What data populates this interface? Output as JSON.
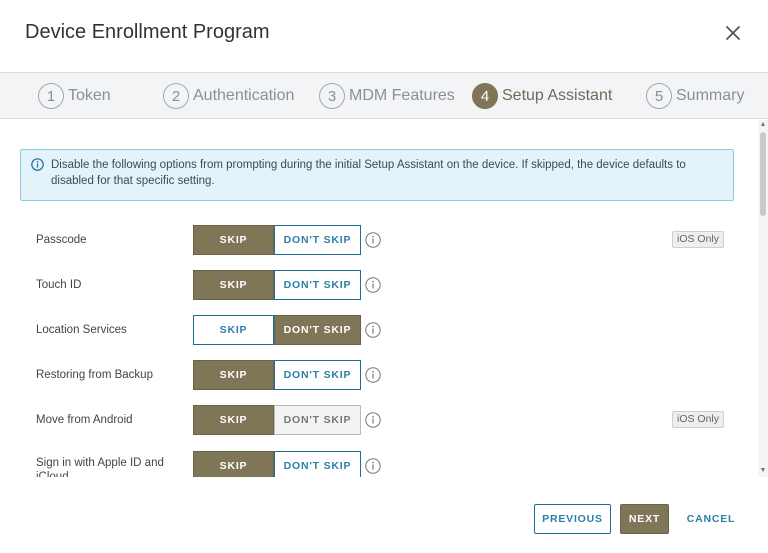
{
  "dialog": {
    "title": "Device Enrollment Program"
  },
  "steps": [
    {
      "num": "1",
      "label": "Token"
    },
    {
      "num": "2",
      "label": "Authentication"
    },
    {
      "num": "3",
      "label": "MDM Features"
    },
    {
      "num": "4",
      "label": "Setup Assistant",
      "active": true
    },
    {
      "num": "5",
      "label": "Summary"
    }
  ],
  "info": {
    "text": "Disable the following options from prompting during the initial Setup Assistant on the device. If skipped, the device defaults to disabled for that specific setting."
  },
  "toggle_labels": {
    "skip": "SKIP",
    "dont_skip": "DON'T SKIP"
  },
  "options": [
    {
      "label": "Passcode",
      "selected": "SKIP",
      "badge": "iOS Only"
    },
    {
      "label": "Touch ID",
      "selected": "SKIP"
    },
    {
      "label": "Location Services",
      "selected": "DON'T SKIP"
    },
    {
      "label": "Restoring from Backup",
      "selected": "SKIP"
    },
    {
      "label": "Move from Android",
      "selected": "SKIP",
      "badge": "iOS Only",
      "dont_skip_disabled": true
    },
    {
      "label": "Sign in with Apple ID and iCloud",
      "selected": "SKIP"
    }
  ],
  "footer": {
    "previous": "PREVIOUS",
    "next": "NEXT",
    "cancel": "CANCEL"
  },
  "colors": {
    "accent": "#7f7557",
    "link": "#2b7fa9",
    "info_bg": "#e3f3f9",
    "info_border": "#8ecae2"
  },
  "icons": {
    "close": "close-icon",
    "info": "info-icon",
    "help": "help-icon"
  }
}
